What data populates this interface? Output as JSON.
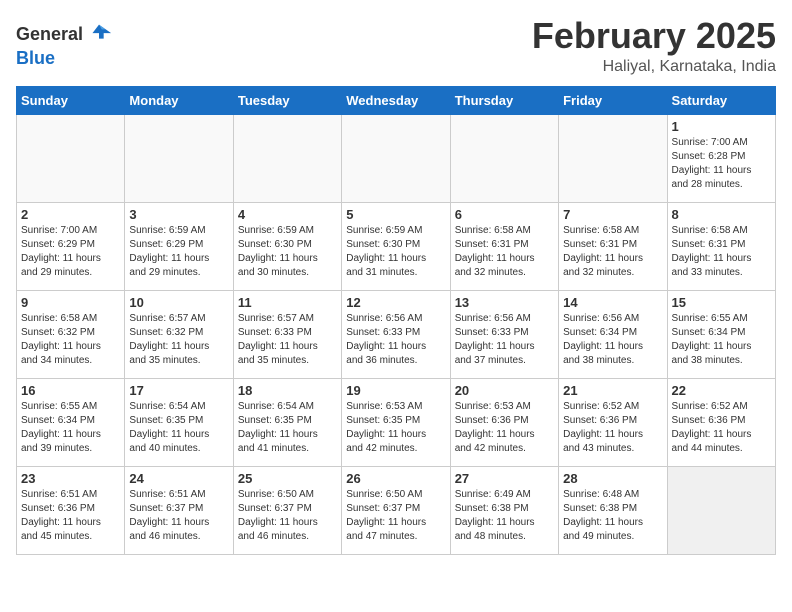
{
  "logo": {
    "general": "General",
    "blue": "Blue"
  },
  "title": "February 2025",
  "subtitle": "Haliyal, Karnataka, India",
  "days_of_week": [
    "Sunday",
    "Monday",
    "Tuesday",
    "Wednesday",
    "Thursday",
    "Friday",
    "Saturday"
  ],
  "weeks": [
    [
      {
        "day": "",
        "info": ""
      },
      {
        "day": "",
        "info": ""
      },
      {
        "day": "",
        "info": ""
      },
      {
        "day": "",
        "info": ""
      },
      {
        "day": "",
        "info": ""
      },
      {
        "day": "",
        "info": ""
      },
      {
        "day": "1",
        "info": "Sunrise: 7:00 AM\nSunset: 6:28 PM\nDaylight: 11 hours\nand 28 minutes."
      }
    ],
    [
      {
        "day": "2",
        "info": "Sunrise: 7:00 AM\nSunset: 6:29 PM\nDaylight: 11 hours\nand 29 minutes."
      },
      {
        "day": "3",
        "info": "Sunrise: 6:59 AM\nSunset: 6:29 PM\nDaylight: 11 hours\nand 29 minutes."
      },
      {
        "day": "4",
        "info": "Sunrise: 6:59 AM\nSunset: 6:30 PM\nDaylight: 11 hours\nand 30 minutes."
      },
      {
        "day": "5",
        "info": "Sunrise: 6:59 AM\nSunset: 6:30 PM\nDaylight: 11 hours\nand 31 minutes."
      },
      {
        "day": "6",
        "info": "Sunrise: 6:58 AM\nSunset: 6:31 PM\nDaylight: 11 hours\nand 32 minutes."
      },
      {
        "day": "7",
        "info": "Sunrise: 6:58 AM\nSunset: 6:31 PM\nDaylight: 11 hours\nand 32 minutes."
      },
      {
        "day": "8",
        "info": "Sunrise: 6:58 AM\nSunset: 6:31 PM\nDaylight: 11 hours\nand 33 minutes."
      }
    ],
    [
      {
        "day": "9",
        "info": "Sunrise: 6:58 AM\nSunset: 6:32 PM\nDaylight: 11 hours\nand 34 minutes."
      },
      {
        "day": "10",
        "info": "Sunrise: 6:57 AM\nSunset: 6:32 PM\nDaylight: 11 hours\nand 35 minutes."
      },
      {
        "day": "11",
        "info": "Sunrise: 6:57 AM\nSunset: 6:33 PM\nDaylight: 11 hours\nand 35 minutes."
      },
      {
        "day": "12",
        "info": "Sunrise: 6:56 AM\nSunset: 6:33 PM\nDaylight: 11 hours\nand 36 minutes."
      },
      {
        "day": "13",
        "info": "Sunrise: 6:56 AM\nSunset: 6:33 PM\nDaylight: 11 hours\nand 37 minutes."
      },
      {
        "day": "14",
        "info": "Sunrise: 6:56 AM\nSunset: 6:34 PM\nDaylight: 11 hours\nand 38 minutes."
      },
      {
        "day": "15",
        "info": "Sunrise: 6:55 AM\nSunset: 6:34 PM\nDaylight: 11 hours\nand 38 minutes."
      }
    ],
    [
      {
        "day": "16",
        "info": "Sunrise: 6:55 AM\nSunset: 6:34 PM\nDaylight: 11 hours\nand 39 minutes."
      },
      {
        "day": "17",
        "info": "Sunrise: 6:54 AM\nSunset: 6:35 PM\nDaylight: 11 hours\nand 40 minutes."
      },
      {
        "day": "18",
        "info": "Sunrise: 6:54 AM\nSunset: 6:35 PM\nDaylight: 11 hours\nand 41 minutes."
      },
      {
        "day": "19",
        "info": "Sunrise: 6:53 AM\nSunset: 6:35 PM\nDaylight: 11 hours\nand 42 minutes."
      },
      {
        "day": "20",
        "info": "Sunrise: 6:53 AM\nSunset: 6:36 PM\nDaylight: 11 hours\nand 42 minutes."
      },
      {
        "day": "21",
        "info": "Sunrise: 6:52 AM\nSunset: 6:36 PM\nDaylight: 11 hours\nand 43 minutes."
      },
      {
        "day": "22",
        "info": "Sunrise: 6:52 AM\nSunset: 6:36 PM\nDaylight: 11 hours\nand 44 minutes."
      }
    ],
    [
      {
        "day": "23",
        "info": "Sunrise: 6:51 AM\nSunset: 6:36 PM\nDaylight: 11 hours\nand 45 minutes."
      },
      {
        "day": "24",
        "info": "Sunrise: 6:51 AM\nSunset: 6:37 PM\nDaylight: 11 hours\nand 46 minutes."
      },
      {
        "day": "25",
        "info": "Sunrise: 6:50 AM\nSunset: 6:37 PM\nDaylight: 11 hours\nand 46 minutes."
      },
      {
        "day": "26",
        "info": "Sunrise: 6:50 AM\nSunset: 6:37 PM\nDaylight: 11 hours\nand 47 minutes."
      },
      {
        "day": "27",
        "info": "Sunrise: 6:49 AM\nSunset: 6:38 PM\nDaylight: 11 hours\nand 48 minutes."
      },
      {
        "day": "28",
        "info": "Sunrise: 6:48 AM\nSunset: 6:38 PM\nDaylight: 11 hours\nand 49 minutes."
      },
      {
        "day": "",
        "info": ""
      }
    ]
  ]
}
